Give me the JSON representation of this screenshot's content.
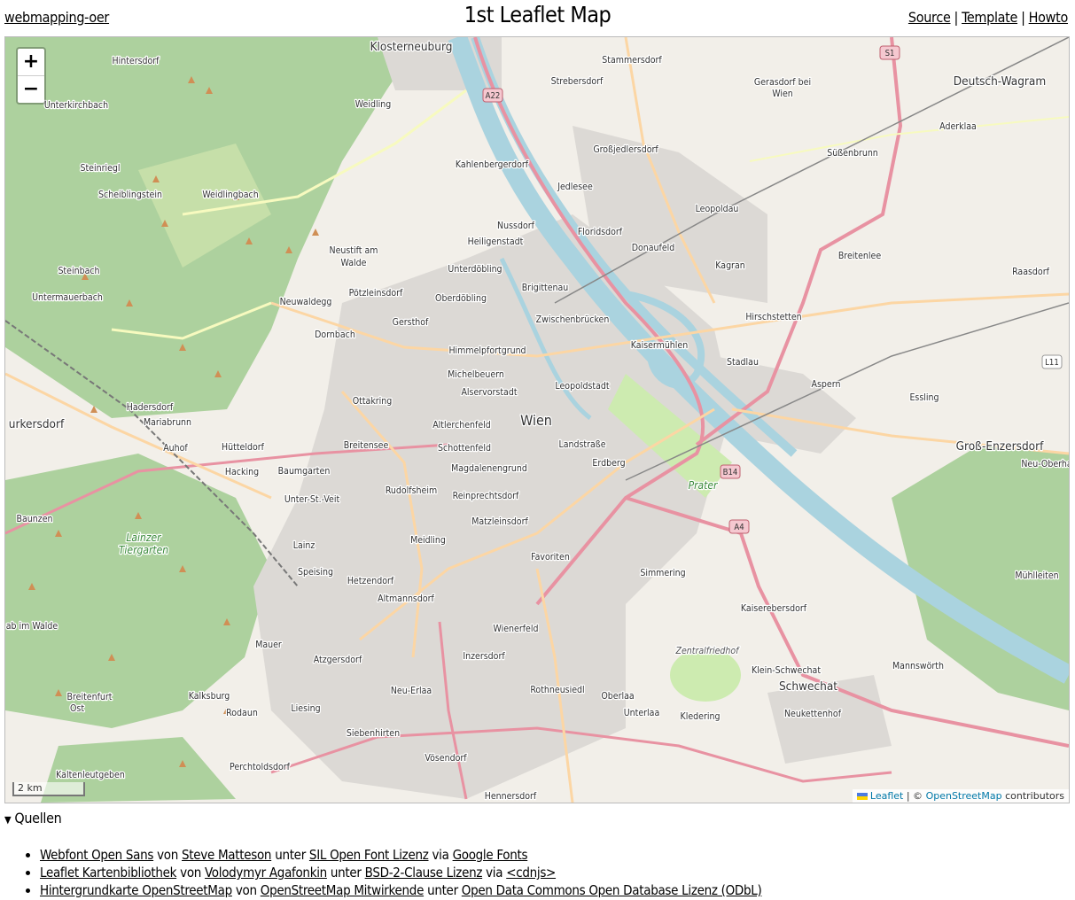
{
  "header": {
    "home_link": "webmapping-oer",
    "title": "1st Leaflet Map",
    "links": [
      "Source",
      "Template",
      "Howto"
    ],
    "separator": "|"
  },
  "map": {
    "zoom_in": "+",
    "zoom_out": "−",
    "scale": "2 km",
    "attribution": {
      "leaflet": "Leaflet",
      "sep": "| ©",
      "osm": "OpenStreetMap",
      "contributors": "contributors"
    },
    "colors": {
      "land": "#f2efe9",
      "forest": "#add19e",
      "meadow": "#cdebb0",
      "urban": "#dcd9d5",
      "water": "#aad3df",
      "motorway": "#e892a2",
      "primary": "#fcd6a4",
      "secondary": "#f7fabf"
    },
    "center_label": "Wien",
    "labels": [
      "Klosterneuburg",
      "Hintersdorf",
      "Stammersdorf",
      "Strebersdorf",
      "Gerasdorf bei",
      "Wien",
      "Deutsch-Wagram",
      "Unterkirchbach",
      "Weidling",
      "Aderklaa",
      "Großjedlersdorf",
      "Süßenbrunn",
      "Kahlenbergerdorf",
      "Steinriegl",
      "Scheiblingstein",
      "Weidlingbach",
      "Jedlesee",
      "Leopoldau",
      "Nussdorf",
      "Floridsdorf",
      "Heiligenstadt",
      "Donaufeld",
      "Neustift am",
      "Walde",
      "Breitenlee",
      "Kagran",
      "Unterdöbling",
      "Steinbach",
      "Raasdorf",
      "Brigittenau",
      "Pötzleinsdorf",
      "Oberdöbling",
      "Untermauerbach",
      "Neuwaldegg",
      "Zwischenbrücken",
      "Hirschstetten",
      "Gersthof",
      "Dornbach",
      "Kaisermühlen",
      "Himmelpfortgrund",
      "Stadlau",
      "Michelbeuern",
      "Alservorstadt",
      "Aspern",
      "Leopoldstadt",
      "Ottakring",
      "Essling",
      "Hadersdorf",
      "Mariabrunn",
      "urkersdorf",
      "Altlerchenfeld",
      "Landstraße",
      "Hütteldorf",
      "Breitensee",
      "Auhof",
      "Schottenfeld",
      "Groß-Enzersdorf",
      "Erdberg",
      "Neu-Oberha",
      "Hacking",
      "Baumgarten",
      "Magdalenengrund",
      "Rudolfsheim",
      "Reinprechtsdorf",
      "Unter-St.-Veit",
      "Baunzen",
      "Matzleinsdorf",
      "Meidling",
      "Lainz",
      "Favoriten",
      "Speising",
      "Simmering",
      "Mühlleiten",
      "Hetzendorf",
      "Altmannsdorf",
      "Kaiserebersdorf",
      "Wienerfeld",
      "Mauer",
      "Inzersdorf",
      "Atzgersdorf",
      "Mannswörth",
      "Klein-Schwechat",
      "Schwechat",
      "Neu-Erlaa",
      "Rothneusiedl",
      "Kalksburg",
      "Breitenfurt",
      "Ost",
      "Oberlaa",
      "Liesing",
      "Rodaun",
      "Unterlaa",
      "Neukettenhof",
      "Kledering",
      "Siebenhirten",
      "Vösendorf",
      "Perchtoldsdorf",
      "Kaltenleutgeben",
      "Hennersdorf",
      "ab im Walde",
      "Lainzer",
      "Tiergarten",
      "Zentralfriedhof",
      "Prater"
    ],
    "road_shields": [
      "A22",
      "S1",
      "B14",
      "A4",
      "L11"
    ]
  },
  "sources": {
    "summary": "Quellen",
    "items": [
      [
        {
          "t": "Webfont Open Sans",
          "link": true
        },
        {
          "t": " von "
        },
        {
          "t": "Steve Matteson",
          "link": true
        },
        {
          "t": " unter "
        },
        {
          "t": "SIL Open Font Lizenz",
          "link": true
        },
        {
          "t": " via "
        },
        {
          "t": "Google Fonts",
          "link": true
        }
      ],
      [
        {
          "t": "Leaflet Kartenbibliothek",
          "link": true
        },
        {
          "t": " von "
        },
        {
          "t": "Volodymyr Agafonkin",
          "link": true
        },
        {
          "t": " unter "
        },
        {
          "t": "BSD-2-Clause Lizenz",
          "link": true
        },
        {
          "t": " via "
        },
        {
          "t": "<cdnjs>",
          "link": true
        }
      ],
      [
        {
          "t": "Hintergrundkarte OpenStreetMap",
          "link": true
        },
        {
          "t": " von "
        },
        {
          "t": "OpenStreetMap Mitwirkende",
          "link": true
        },
        {
          "t": " unter "
        },
        {
          "t": "Open Data Commons Open Database Lizenz (ODbL)",
          "link": true
        }
      ]
    ]
  }
}
